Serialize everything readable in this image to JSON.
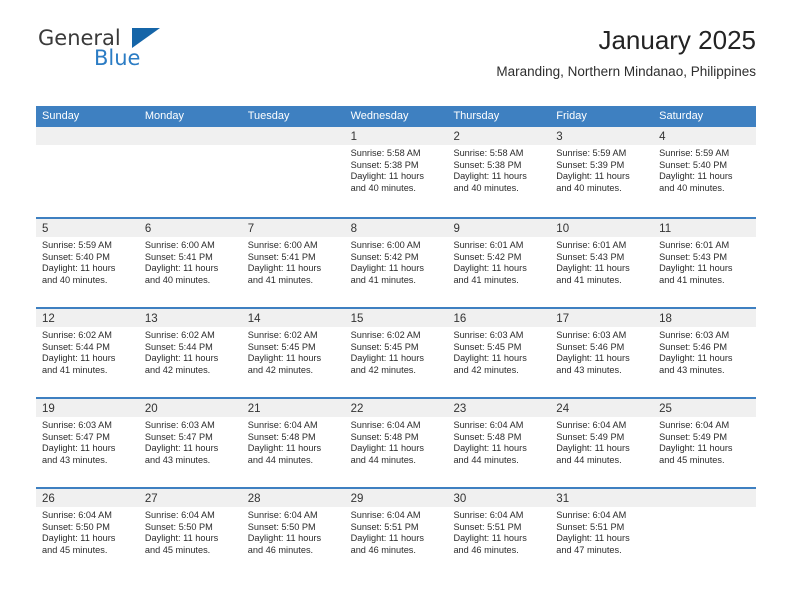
{
  "brand": {
    "name_top": "General",
    "name_bottom": "Blue",
    "accent_color": "#2b7cc4",
    "triangle_color": "#1565a8"
  },
  "header": {
    "title": "January 2025",
    "subtitle": "Maranding, Northern Mindanao, Philippines"
  },
  "theme": {
    "header_bar_color": "#3e80c1",
    "day_band_color": "#f0f0f0",
    "text_color": "#2b2b2b"
  },
  "weekdays": [
    "Sunday",
    "Monday",
    "Tuesday",
    "Wednesday",
    "Thursday",
    "Friday",
    "Saturday"
  ],
  "weeks": [
    [
      {
        "empty": true
      },
      {
        "empty": true
      },
      {
        "empty": true
      },
      {
        "day": "1",
        "sunrise": "Sunrise: 5:58 AM",
        "sunset": "Sunset: 5:38 PM",
        "daylight_1": "Daylight: 11 hours",
        "daylight_2": "and 40 minutes."
      },
      {
        "day": "2",
        "sunrise": "Sunrise: 5:58 AM",
        "sunset": "Sunset: 5:38 PM",
        "daylight_1": "Daylight: 11 hours",
        "daylight_2": "and 40 minutes."
      },
      {
        "day": "3",
        "sunrise": "Sunrise: 5:59 AM",
        "sunset": "Sunset: 5:39 PM",
        "daylight_1": "Daylight: 11 hours",
        "daylight_2": "and 40 minutes."
      },
      {
        "day": "4",
        "sunrise": "Sunrise: 5:59 AM",
        "sunset": "Sunset: 5:40 PM",
        "daylight_1": "Daylight: 11 hours",
        "daylight_2": "and 40 minutes."
      }
    ],
    [
      {
        "day": "5",
        "sunrise": "Sunrise: 5:59 AM",
        "sunset": "Sunset: 5:40 PM",
        "daylight_1": "Daylight: 11 hours",
        "daylight_2": "and 40 minutes."
      },
      {
        "day": "6",
        "sunrise": "Sunrise: 6:00 AM",
        "sunset": "Sunset: 5:41 PM",
        "daylight_1": "Daylight: 11 hours",
        "daylight_2": "and 40 minutes."
      },
      {
        "day": "7",
        "sunrise": "Sunrise: 6:00 AM",
        "sunset": "Sunset: 5:41 PM",
        "daylight_1": "Daylight: 11 hours",
        "daylight_2": "and 41 minutes."
      },
      {
        "day": "8",
        "sunrise": "Sunrise: 6:00 AM",
        "sunset": "Sunset: 5:42 PM",
        "daylight_1": "Daylight: 11 hours",
        "daylight_2": "and 41 minutes."
      },
      {
        "day": "9",
        "sunrise": "Sunrise: 6:01 AM",
        "sunset": "Sunset: 5:42 PM",
        "daylight_1": "Daylight: 11 hours",
        "daylight_2": "and 41 minutes."
      },
      {
        "day": "10",
        "sunrise": "Sunrise: 6:01 AM",
        "sunset": "Sunset: 5:43 PM",
        "daylight_1": "Daylight: 11 hours",
        "daylight_2": "and 41 minutes."
      },
      {
        "day": "11",
        "sunrise": "Sunrise: 6:01 AM",
        "sunset": "Sunset: 5:43 PM",
        "daylight_1": "Daylight: 11 hours",
        "daylight_2": "and 41 minutes."
      }
    ],
    [
      {
        "day": "12",
        "sunrise": "Sunrise: 6:02 AM",
        "sunset": "Sunset: 5:44 PM",
        "daylight_1": "Daylight: 11 hours",
        "daylight_2": "and 41 minutes."
      },
      {
        "day": "13",
        "sunrise": "Sunrise: 6:02 AM",
        "sunset": "Sunset: 5:44 PM",
        "daylight_1": "Daylight: 11 hours",
        "daylight_2": "and 42 minutes."
      },
      {
        "day": "14",
        "sunrise": "Sunrise: 6:02 AM",
        "sunset": "Sunset: 5:45 PM",
        "daylight_1": "Daylight: 11 hours",
        "daylight_2": "and 42 minutes."
      },
      {
        "day": "15",
        "sunrise": "Sunrise: 6:02 AM",
        "sunset": "Sunset: 5:45 PM",
        "daylight_1": "Daylight: 11 hours",
        "daylight_2": "and 42 minutes."
      },
      {
        "day": "16",
        "sunrise": "Sunrise: 6:03 AM",
        "sunset": "Sunset: 5:45 PM",
        "daylight_1": "Daylight: 11 hours",
        "daylight_2": "and 42 minutes."
      },
      {
        "day": "17",
        "sunrise": "Sunrise: 6:03 AM",
        "sunset": "Sunset: 5:46 PM",
        "daylight_1": "Daylight: 11 hours",
        "daylight_2": "and 43 minutes."
      },
      {
        "day": "18",
        "sunrise": "Sunrise: 6:03 AM",
        "sunset": "Sunset: 5:46 PM",
        "daylight_1": "Daylight: 11 hours",
        "daylight_2": "and 43 minutes."
      }
    ],
    [
      {
        "day": "19",
        "sunrise": "Sunrise: 6:03 AM",
        "sunset": "Sunset: 5:47 PM",
        "daylight_1": "Daylight: 11 hours",
        "daylight_2": "and 43 minutes."
      },
      {
        "day": "20",
        "sunrise": "Sunrise: 6:03 AM",
        "sunset": "Sunset: 5:47 PM",
        "daylight_1": "Daylight: 11 hours",
        "daylight_2": "and 43 minutes."
      },
      {
        "day": "21",
        "sunrise": "Sunrise: 6:04 AM",
        "sunset": "Sunset: 5:48 PM",
        "daylight_1": "Daylight: 11 hours",
        "daylight_2": "and 44 minutes."
      },
      {
        "day": "22",
        "sunrise": "Sunrise: 6:04 AM",
        "sunset": "Sunset: 5:48 PM",
        "daylight_1": "Daylight: 11 hours",
        "daylight_2": "and 44 minutes."
      },
      {
        "day": "23",
        "sunrise": "Sunrise: 6:04 AM",
        "sunset": "Sunset: 5:48 PM",
        "daylight_1": "Daylight: 11 hours",
        "daylight_2": "and 44 minutes."
      },
      {
        "day": "24",
        "sunrise": "Sunrise: 6:04 AM",
        "sunset": "Sunset: 5:49 PM",
        "daylight_1": "Daylight: 11 hours",
        "daylight_2": "and 44 minutes."
      },
      {
        "day": "25",
        "sunrise": "Sunrise: 6:04 AM",
        "sunset": "Sunset: 5:49 PM",
        "daylight_1": "Daylight: 11 hours",
        "daylight_2": "and 45 minutes."
      }
    ],
    [
      {
        "day": "26",
        "sunrise": "Sunrise: 6:04 AM",
        "sunset": "Sunset: 5:50 PM",
        "daylight_1": "Daylight: 11 hours",
        "daylight_2": "and 45 minutes."
      },
      {
        "day": "27",
        "sunrise": "Sunrise: 6:04 AM",
        "sunset": "Sunset: 5:50 PM",
        "daylight_1": "Daylight: 11 hours",
        "daylight_2": "and 45 minutes."
      },
      {
        "day": "28",
        "sunrise": "Sunrise: 6:04 AM",
        "sunset": "Sunset: 5:50 PM",
        "daylight_1": "Daylight: 11 hours",
        "daylight_2": "and 46 minutes."
      },
      {
        "day": "29",
        "sunrise": "Sunrise: 6:04 AM",
        "sunset": "Sunset: 5:51 PM",
        "daylight_1": "Daylight: 11 hours",
        "daylight_2": "and 46 minutes."
      },
      {
        "day": "30",
        "sunrise": "Sunrise: 6:04 AM",
        "sunset": "Sunset: 5:51 PM",
        "daylight_1": "Daylight: 11 hours",
        "daylight_2": "and 46 minutes."
      },
      {
        "day": "31",
        "sunrise": "Sunrise: 6:04 AM",
        "sunset": "Sunset: 5:51 PM",
        "daylight_1": "Daylight: 11 hours",
        "daylight_2": "and 47 minutes."
      },
      {
        "empty": true
      }
    ]
  ]
}
